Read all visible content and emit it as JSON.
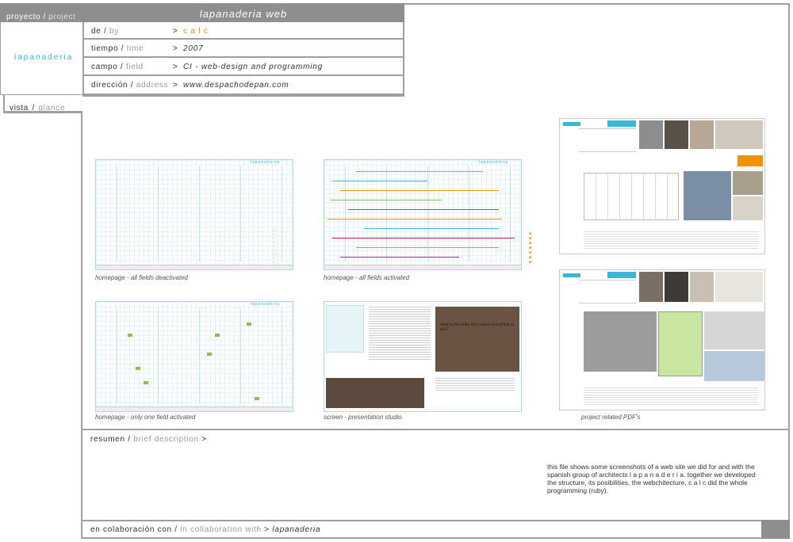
{
  "header": {
    "proyecto_es": "proyecto",
    "proyecto_sep": " / ",
    "proyecto_en": "project",
    "title": "lapanaderia web",
    "sidebar_name": "lapanaderia"
  },
  "info_rows": [
    {
      "es": "de",
      "en": "by",
      "value": "c a l c"
    },
    {
      "es": "tiempo",
      "en": "time",
      "value": "2007"
    },
    {
      "es": "campo",
      "en": "field",
      "value": "CI - web-design and programming"
    },
    {
      "es": "dirección",
      "en": "address",
      "value": "www.despachodepan.com"
    }
  ],
  "arrow": ">",
  "sep": "/",
  "vista": {
    "es": "vista",
    "en": "glance"
  },
  "captions": [
    "homepage - all fields deactivated",
    "homepage - all fields activated",
    "project related PDF's",
    "homepage - only one field activated",
    "screen - presentation studio"
  ],
  "thumb_logo": "lapanaderia",
  "screen_quote": "what is the value that makes everything to you?",
  "resumen": {
    "es": "resumen",
    "en": "brief description",
    "arrow": ">"
  },
  "description": "this file shows some screenshots of a web site we did for and with the spanish group of architects l a p a n a d e r i a. together we developed the structure, its posibilities, the webchitecture, c a l c did the whole programming (ruby).",
  "collab": {
    "es": "en colaboración con",
    "en": "in collaboration with",
    "arrow": ">",
    "value": "lapanaderia"
  },
  "colors": {
    "panel_gray": "#8e8e8e",
    "accent_cyan": "#3bb7d6",
    "accent_orange": "#f39200",
    "border": "#a0a0a0"
  }
}
